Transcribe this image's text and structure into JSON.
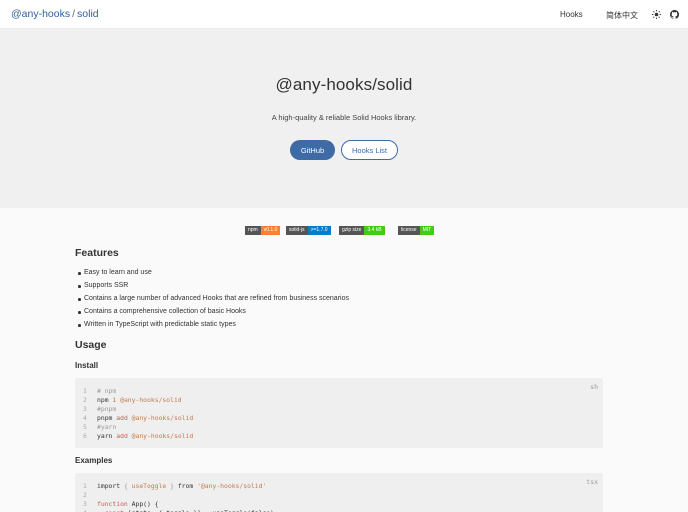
{
  "header": {
    "brand_part1": "@any-hooks",
    "brand_sep": "/",
    "brand_part2": "solid",
    "nav_hooks": "Hooks",
    "nav_lang": "简体中文",
    "icons": [
      "sun-icon",
      "github-icon"
    ]
  },
  "hero": {
    "title": "@any-hooks/solid",
    "subtitle": "A high-quality & reliable Solid Hooks library.",
    "btn_github": "GitHub",
    "btn_hooks": "Hooks List",
    "accent": "#3e6aa6"
  },
  "badges": [
    {
      "label": "npm",
      "value": "v0.1.0",
      "color": "#fe7d37"
    },
    {
      "label": "solid-js",
      "value": ">=1.7.0",
      "color": "#007ec6"
    },
    {
      "label": "gzip size",
      "value": "3.4 kB",
      "color": "#4c1"
    },
    {
      "label": "license",
      "value": "MIT",
      "color": "#4c1"
    }
  ],
  "features": {
    "heading": "Features",
    "items": [
      "Easy to learn and use",
      "Supports SSR",
      "Contains a large number of advanced Hooks that are refined from business scenarios",
      "Contains a comprehensive collection of basic Hooks",
      "Written in TypeScript with predictable static types"
    ]
  },
  "usage": {
    "heading": "Usage",
    "install_heading": "Install",
    "install_lang": "sh",
    "install_lines": [
      {
        "n": "1",
        "parts": [
          {
            "t": "# npm",
            "c": "c-comment"
          }
        ]
      },
      {
        "n": "2",
        "parts": [
          {
            "t": "npm ",
            "c": "c-plain"
          },
          {
            "t": "i",
            "c": "c-kw"
          },
          {
            "t": " @any-hooks/solid",
            "c": "c-str"
          }
        ]
      },
      {
        "n": "3",
        "parts": [
          {
            "t": "#pnpm",
            "c": "c-comment"
          }
        ]
      },
      {
        "n": "4",
        "parts": [
          {
            "t": "pnpm ",
            "c": "c-plain"
          },
          {
            "t": "add",
            "c": "c-kw"
          },
          {
            "t": " @any-hooks/solid",
            "c": "c-str"
          }
        ]
      },
      {
        "n": "5",
        "parts": [
          {
            "t": "#yarn",
            "c": "c-comment"
          }
        ]
      },
      {
        "n": "6",
        "parts": [
          {
            "t": "yarn ",
            "c": "c-plain"
          },
          {
            "t": "add",
            "c": "c-kw"
          },
          {
            "t": " @any-hooks/solid",
            "c": "c-str"
          }
        ]
      }
    ],
    "examples_heading": "Examples",
    "examples_lang": "tsx",
    "example_lines": [
      {
        "n": "1",
        "parts": [
          {
            "t": "import ",
            "c": "c-plain"
          },
          {
            "t": "{ ",
            "c": "c-comment"
          },
          {
            "t": "useToggle",
            "c": "c-fn"
          },
          {
            "t": " } ",
            "c": "c-comment"
          },
          {
            "t": "from ",
            "c": "c-plain"
          },
          {
            "t": "'@any-hooks/solid'",
            "c": "c-str"
          }
        ]
      },
      {
        "n": "2",
        "parts": [
          {
            "t": "",
            "c": "c-plain"
          }
        ]
      },
      {
        "n": "3",
        "parts": [
          {
            "t": "function",
            "c": "c-kw"
          },
          {
            "t": " App() {",
            "c": "c-plain"
          }
        ]
      },
      {
        "n": "4",
        "parts": [
          {
            "t": "  const",
            "c": "c-kw"
          },
          {
            "t": " [state, { toggle }] = useToggle(false)",
            "c": "c-plain"
          }
        ]
      }
    ]
  }
}
